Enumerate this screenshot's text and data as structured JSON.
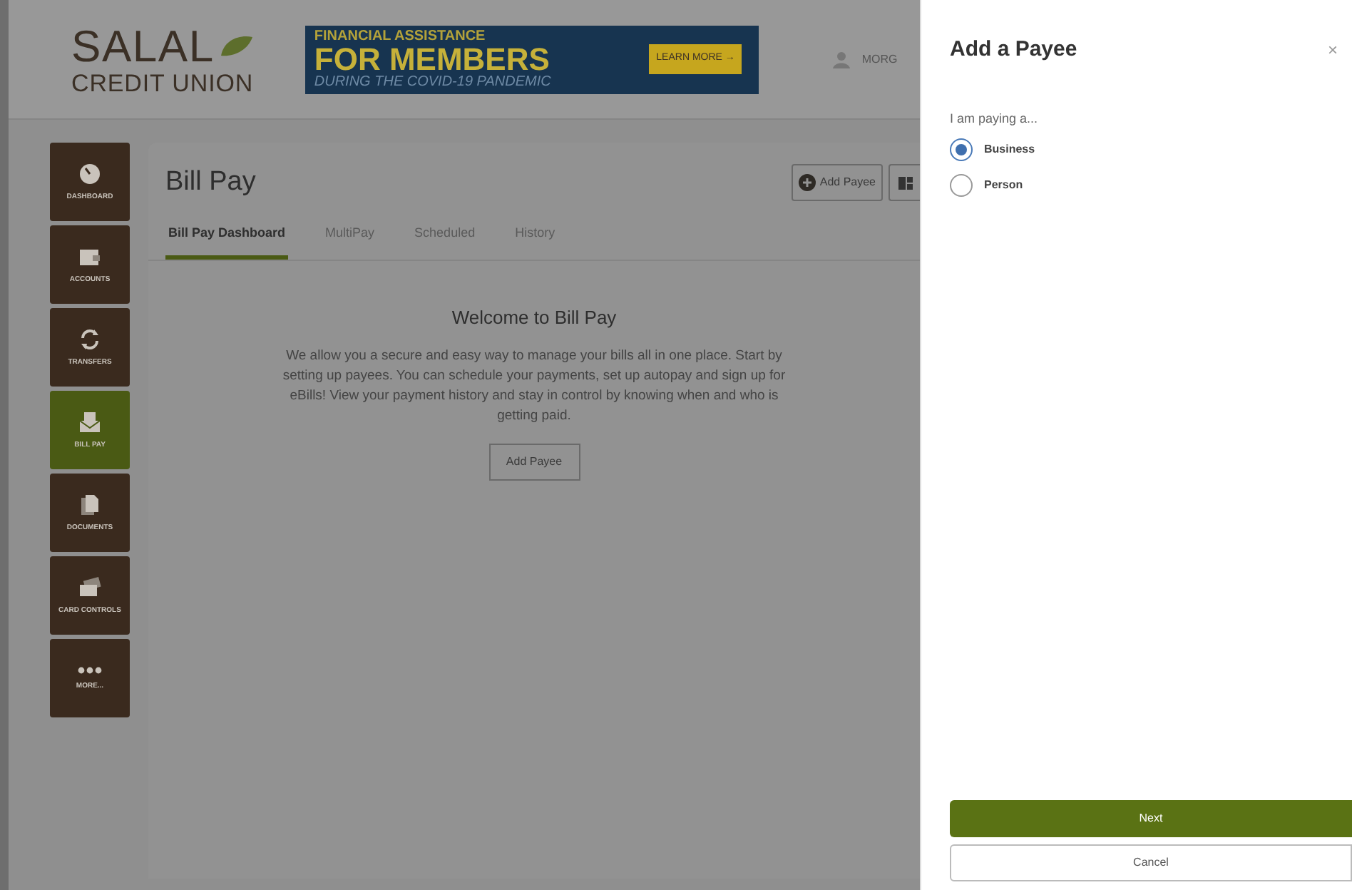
{
  "header": {
    "logo": {
      "name": "SALAL",
      "subtitle": "CREDIT UNION"
    },
    "banner": {
      "line_1": "FINANCIAL ASSISTANCE",
      "line_2": "FOR MEMBERS",
      "line_3": "DURING THE COVID-19 PANDEMIC",
      "button": "LEARN MORE →"
    },
    "user": "MORG"
  },
  "sidebar": {
    "items": [
      {
        "label": "DASHBOARD",
        "kind": "gauge",
        "selected": false
      },
      {
        "label": "ACCOUNTS",
        "kind": "wallet",
        "selected": false
      },
      {
        "label": "TRANSFERS",
        "kind": "arrows",
        "selected": false
      },
      {
        "label": "BILL PAY",
        "kind": "envelope",
        "selected": true
      },
      {
        "label": "DOCUMENTS",
        "kind": "documents",
        "selected": false
      },
      {
        "label": "CARD CONTROLS",
        "kind": "card",
        "selected": false
      },
      {
        "label": "MORE...",
        "kind": "dots",
        "selected": false
      }
    ]
  },
  "page": {
    "title": "Bill Pay",
    "add_payee_button": "Add Payee",
    "tabs": [
      {
        "label": "Bill Pay Dashboard",
        "selected": true
      },
      {
        "label": "MultiPay",
        "selected": false
      },
      {
        "label": "Scheduled",
        "selected": false
      },
      {
        "label": "History",
        "selected": false
      }
    ],
    "welcome": {
      "heading": "Welcome to Bill Pay",
      "text": "We allow you a secure and easy way to manage your bills all in one place. Start by setting up payees. You can schedule your payments, set up autopay and sign up for eBills! View your payment history and stay in control by knowing when and who is getting paid.",
      "button": "Add Payee"
    }
  },
  "dialog": {
    "title": "Add a Payee",
    "close": "×",
    "prompt": "I am paying a...",
    "options": [
      {
        "label": "Business",
        "selected": true
      },
      {
        "label": "Person",
        "selected": false
      }
    ],
    "buttons": {
      "primary": "Next",
      "secondary": "Cancel"
    }
  }
}
